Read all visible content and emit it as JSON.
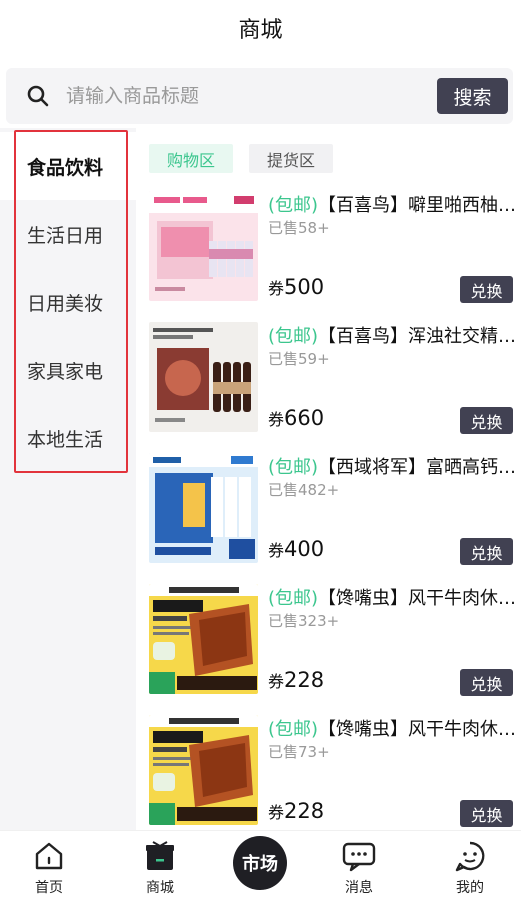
{
  "header": {
    "title": "商城"
  },
  "search": {
    "placeholder": "请输入商品标题",
    "button": "搜索"
  },
  "sidebar": {
    "items": [
      {
        "label": "食品饮料",
        "active": true
      },
      {
        "label": "生活日用",
        "active": false
      },
      {
        "label": "日用美妆",
        "active": false
      },
      {
        "label": "家具家电",
        "active": false
      },
      {
        "label": "本地生活",
        "active": false
      }
    ]
  },
  "tabs": [
    {
      "label": "购物区",
      "active": true
    },
    {
      "label": "提货区",
      "active": false
    }
  ],
  "products": [
    {
      "ship": "(包邮)",
      "title": "【百喜鸟】噼里啪西柚精酿啤酒",
      "sold": "已售58+",
      "currency": "券",
      "price": "500",
      "button": "兑换"
    },
    {
      "ship": "(包邮)",
      "title": "【百喜鸟】浑浊社交精酿IPA啤酒",
      "sold": "已售59+",
      "currency": "券",
      "price": "660",
      "button": "兑换"
    },
    {
      "ship": "(包邮)",
      "title": "【西域将军】富晒高钙奶粉",
      "sold": "已售482+",
      "currency": "券",
      "price": "400",
      "button": "兑换"
    },
    {
      "ship": "(包邮)",
      "title": "【馋嘴虫】风干牛肉休闲零食",
      "sold": "已售323+",
      "currency": "券",
      "price": "228",
      "button": "兑换"
    },
    {
      "ship": "(包邮)",
      "title": "【馋嘴虫】风干牛肉休闲零食",
      "sold": "已售73+",
      "currency": "券",
      "price": "228",
      "button": "兑换"
    }
  ],
  "bottom_nav": {
    "home": "首页",
    "mall": "商城",
    "market": "市场",
    "messages": "消息",
    "mine": "我的"
  },
  "colors": {
    "accent": "#3cc68e",
    "dark": "#414152",
    "highlight_frame": "#e2333c"
  }
}
